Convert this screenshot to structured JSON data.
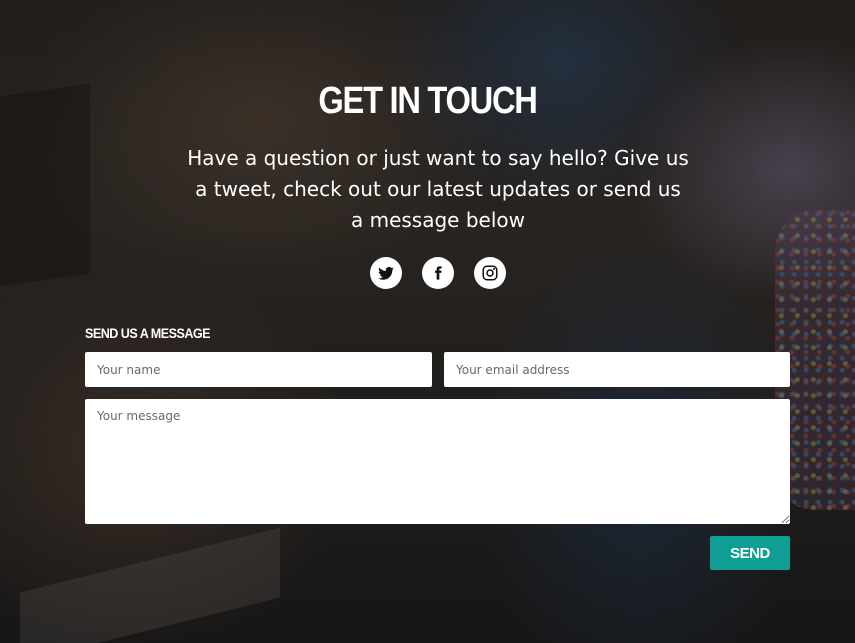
{
  "contact": {
    "title": "GET IN TOUCH",
    "subtitle": "Have a question or just want to say hello? Give us a tweet, check out our latest updates or send us a message below",
    "socials": [
      {
        "name": "twitter",
        "icon": "twitter-icon"
      },
      {
        "name": "facebook",
        "icon": "facebook-icon"
      },
      {
        "name": "instagram",
        "icon": "instagram-icon"
      }
    ]
  },
  "form": {
    "heading": "SEND US A MESSAGE",
    "name_placeholder": "Your name",
    "email_placeholder": "Your email address",
    "message_placeholder": "Your message",
    "send_label": "SEND"
  },
  "colors": {
    "accent": "#0e9e93",
    "text": "#ffffff",
    "field_bg": "#ffffff"
  }
}
